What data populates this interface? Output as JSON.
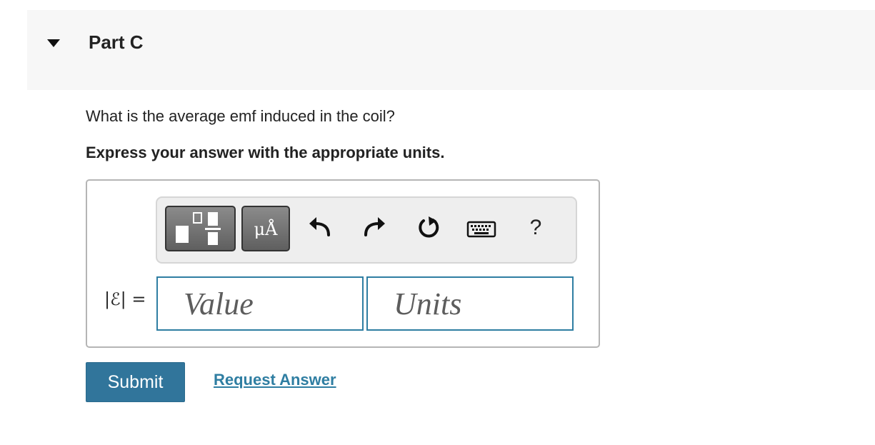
{
  "part": {
    "title": "Part C"
  },
  "question": {
    "text": "What is the average emf induced in the coil?",
    "instruction": "Express your answer with the appropriate units."
  },
  "toolbar": {
    "units_button_label": "μÅ",
    "help_label": "?"
  },
  "answer": {
    "variable_label": "|ℰ| =",
    "value_placeholder": "Value",
    "units_placeholder": "Units"
  },
  "actions": {
    "submit_label": "Submit",
    "request_label": "Request Answer"
  },
  "colors": {
    "accent": "#31759b",
    "field_border": "#2f7ea2",
    "header_bg": "#f7f7f7"
  }
}
